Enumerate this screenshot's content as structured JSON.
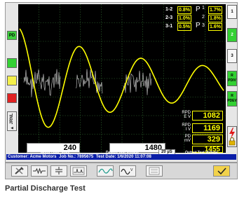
{
  "left_panel": {
    "pd_label": "PD",
    "view_label": "► JRNL"
  },
  "phase_table": {
    "rows": [
      {
        "label": "1-2",
        "pct": "0.8%"
      },
      {
        "label": "2-3",
        "pct": "1.0%"
      },
      {
        "label": "3-1",
        "pct": "0.5%"
      }
    ],
    "p_rows": [
      {
        "sub": "1",
        "pct": "1.7%"
      },
      {
        "sub": "2",
        "pct": "1.8%"
      },
      {
        "sub": "3",
        "pct": "1.6%"
      }
    ],
    "p_symbol": "P"
  },
  "readouts": [
    {
      "label_line1": "RPD",
      "label_line2": "E V",
      "value": "1082"
    },
    {
      "label_line1": "RPD",
      "label_line2": "I V",
      "value": "1169"
    },
    {
      "label_line1": "PD",
      "label_line2": "mV",
      "value": "329"
    },
    {
      "label_line1": "",
      "label_line2": "",
      "value": "1455"
    }
  ],
  "bottom": {
    "motor_volts_value": "240",
    "motor_volts_label": "Motor Oper. Volts",
    "design_volts_value": "1480",
    "design_volts_label": "Design Test Voltage",
    "timebase": "20 µS",
    "output_label": "Output Test Voltage"
  },
  "right_panel": {
    "btn1": "1",
    "btn2": "2",
    "btn3": "3",
    "pdiv": "R\nPDIV",
    "pdev": "R\nPDEV"
  },
  "info_bar": {
    "customer": "Customer: Acme Motors",
    "job": "Job No.: 7895675",
    "date": "Test Date: 1/6/2020 11:07:08"
  },
  "toolbar": {
    "buttons": [
      "wrench-icon",
      "resistor-icon",
      "capacitor-icon",
      "pulse-icon",
      "wave-icon",
      "waveform-icon",
      "list-icon",
      "check-icon"
    ]
  },
  "caption": "Partial Discharge Test",
  "colors": {
    "scope_bg": "#000000",
    "trace": "#ffff00",
    "noise": "#d8d8d8",
    "info_bg": "#0a1ea8",
    "accent_green": "#33d133"
  }
}
